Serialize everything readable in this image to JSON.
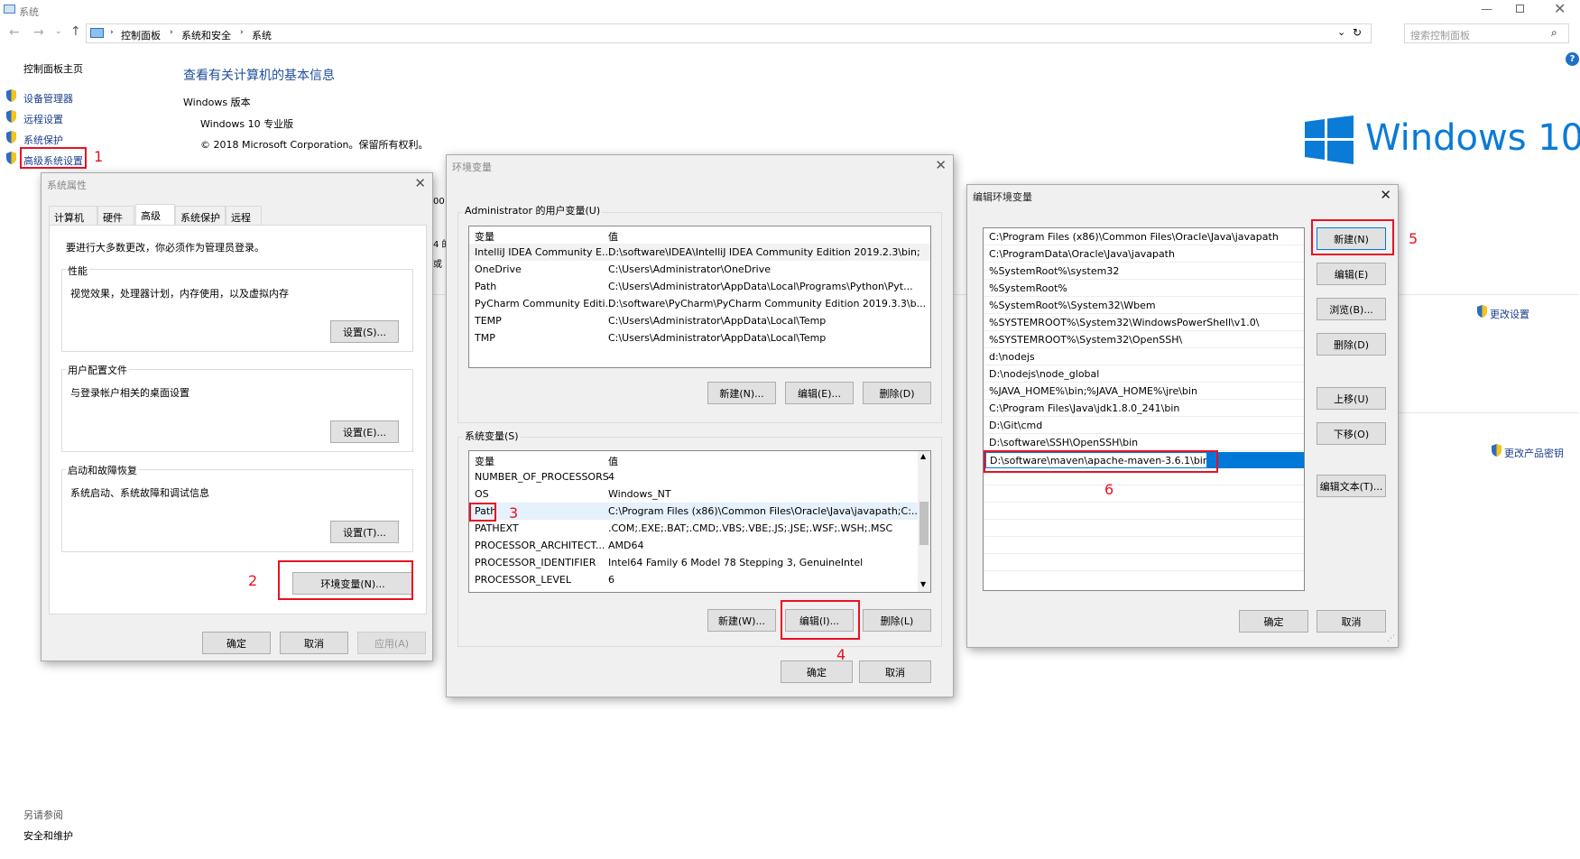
{
  "explorer": {
    "window_title": "系统",
    "breadcrumb": [
      "控制面板",
      "系统和安全",
      "系统"
    ],
    "search_placeholder": "搜索控制面板",
    "sidebar_home": "控制面板主页",
    "sidebar_links": [
      "设备管理器",
      "远程设置",
      "系统保护",
      "高级系统设置"
    ],
    "main_title": "查看有关计算机的基本信息",
    "windows_version_label": "Windows 版本",
    "edition": "Windows 10 专业版",
    "copyright": "© 2018 Microsoft Corporation。保留所有权利。",
    "logo_text": "Windows 10",
    "change_settings": "更改设置",
    "change_product_key": "更改产品密钥",
    "see_also": "另请参阅",
    "security_maintenance": "安全和维护",
    "partial_texts": [
      "00",
      "4 的",
      "或"
    ]
  },
  "sysprop": {
    "title": "系统属性",
    "tabs": [
      "计算机名",
      "硬件",
      "高级",
      "系统保护",
      "远程"
    ],
    "admin_notice": "要进行大多数更改，你必须作为管理员登录。",
    "perf_label": "性能",
    "perf_desc": "视觉效果，处理器计划，内存使用，以及虚拟内存",
    "perf_btn": "设置(S)...",
    "profile_label": "用户配置文件",
    "profile_desc": "与登录帐户相关的桌面设置",
    "profile_btn": "设置(E)...",
    "startup_label": "启动和故障恢复",
    "startup_desc": "系统启动、系统故障和调试信息",
    "startup_btn": "设置(T)...",
    "env_btn": "环境变量(N)...",
    "ok": "确定",
    "cancel": "取消",
    "apply": "应用(A)"
  },
  "envvars": {
    "title": "环境变量",
    "user_group": "Administrator 的用户变量(U)",
    "col_var": "变量",
    "col_val": "值",
    "user_rows": [
      {
        "var": "IntelliJ IDEA Community E...",
        "val": "D:\\software\\IDEA\\IntelliJ IDEA Community Edition 2019.2.3\\bin;"
      },
      {
        "var": "OneDrive",
        "val": "C:\\Users\\Administrator\\OneDrive"
      },
      {
        "var": "Path",
        "val": "C:\\Users\\Administrator\\AppData\\Local\\Programs\\Python\\Pyt..."
      },
      {
        "var": "PyCharm Community Editi...",
        "val": "D:\\software\\PyCharm\\PyCharm Community Edition 2019.3.3\\b..."
      },
      {
        "var": "TEMP",
        "val": "C:\\Users\\Administrator\\AppData\\Local\\Temp"
      },
      {
        "var": "TMP",
        "val": "C:\\Users\\Administrator\\AppData\\Local\\Temp"
      }
    ],
    "user_new": "新建(N)...",
    "user_edit": "编辑(E)...",
    "user_delete": "删除(D)",
    "sys_group": "系统变量(S)",
    "sys_rows": [
      {
        "var": "NUMBER_OF_PROCESSORS",
        "val": "4"
      },
      {
        "var": "OS",
        "val": "Windows_NT"
      },
      {
        "var": "Path",
        "val": "C:\\Program Files (x86)\\Common Files\\Oracle\\Java\\javapath;C:..."
      },
      {
        "var": "PATHEXT",
        "val": ".COM;.EXE;.BAT;.CMD;.VBS;.VBE;.JS;.JSE;.WSF;.WSH;.MSC"
      },
      {
        "var": "PROCESSOR_ARCHITECT...",
        "val": "AMD64"
      },
      {
        "var": "PROCESSOR_IDENTIFIER",
        "val": "Intel64 Family 6 Model 78 Stepping 3, GenuineIntel"
      },
      {
        "var": "PROCESSOR_LEVEL",
        "val": "6"
      }
    ],
    "sys_new": "新建(W)...",
    "sys_edit": "编辑(I)...",
    "sys_delete": "删除(L)",
    "ok": "确定",
    "cancel": "取消"
  },
  "editenv": {
    "title": "编辑环境变量",
    "paths": [
      "C:\\Program Files (x86)\\Common Files\\Oracle\\Java\\javapath",
      "C:\\ProgramData\\Oracle\\Java\\javapath",
      "%SystemRoot%\\system32",
      "%SystemRoot%",
      "%SystemRoot%\\System32\\Wbem",
      "%SYSTEMROOT%\\System32\\WindowsPowerShell\\v1.0\\",
      "%SYSTEMROOT%\\System32\\OpenSSH\\",
      "d:\\nodejs",
      "D:\\nodejs\\node_global",
      "%JAVA_HOME%\\bin;%JAVA_HOME%\\jre\\bin",
      "C:\\Program Files\\Java\\jdk1.8.0_241\\bin",
      "D:\\Git\\cmd",
      "D:\\software\\SSH\\OpenSSH\\bin"
    ],
    "editing_value": "D:\\software\\maven\\apache-maven-3.6.1\\bin",
    "new_btn": "新建(N)",
    "edit_btn": "编辑(E)",
    "browse_btn": "浏览(B)...",
    "delete_btn": "删除(D)",
    "up_btn": "上移(U)",
    "down_btn": "下移(O)",
    "edit_text_btn": "编辑文本(T)...",
    "ok": "确定",
    "cancel": "取消"
  },
  "annotations": [
    "1",
    "2",
    "3",
    "4",
    "5",
    "6"
  ],
  "colors": {
    "accent": "#0078d7",
    "annotation": "#e81123",
    "link": "#1a3e8c"
  }
}
